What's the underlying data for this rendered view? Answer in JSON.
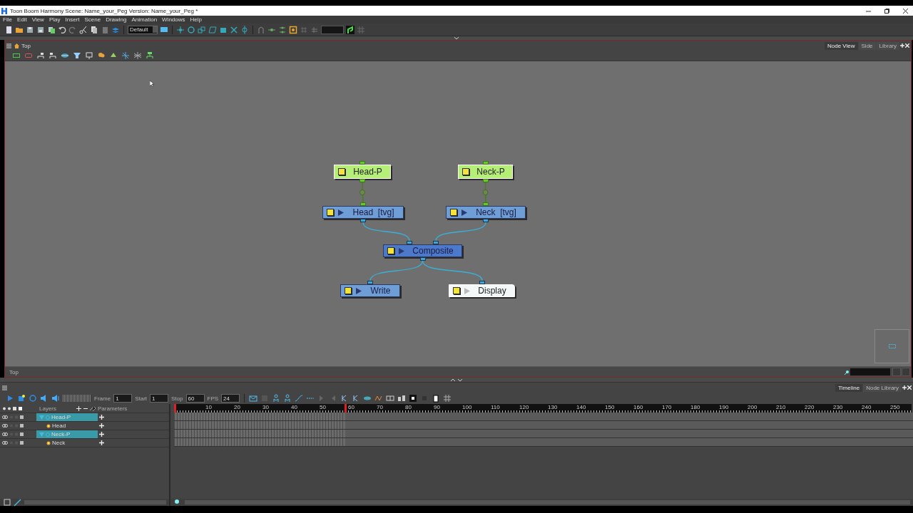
{
  "window": {
    "title": "Toon Boom Harmony Scene: Name_your_Peg Version: Name_your_Peg *"
  },
  "menu": [
    "File",
    "Edit",
    "View",
    "Play",
    "Insert",
    "Scene",
    "Drawing",
    "Animation",
    "Windows",
    "Help"
  ],
  "toolbar": {
    "view_dropdown": "Default"
  },
  "node_view": {
    "breadcrumb": "Top",
    "tabs": [
      {
        "label": "Node View",
        "selected": true
      },
      {
        "label": "Side",
        "selected": false
      },
      {
        "label": "Library",
        "selected": false
      }
    ],
    "nodes": [
      {
        "label": "Head-P",
        "kind": "peg"
      },
      {
        "label": "Neck-P",
        "kind": "peg"
      },
      {
        "label": "Head  [tvg]",
        "kind": "drawing"
      },
      {
        "label": "Neck  [tvg]",
        "kind": "drawing"
      },
      {
        "label": "Composite",
        "kind": "composite"
      },
      {
        "label": "Write",
        "kind": "write"
      },
      {
        "label": "Display",
        "kind": "display"
      }
    ],
    "footer_label": "Top"
  },
  "timeline": {
    "tabs": [
      {
        "label": "Timeline",
        "selected": true
      },
      {
        "label": "Node Library",
        "selected": false
      }
    ],
    "fields": [
      {
        "label": "Frame",
        "value": "1"
      },
      {
        "label": "Start",
        "value": "1"
      },
      {
        "label": "Stop",
        "value": "60"
      },
      {
        "label": "FPS",
        "value": "24"
      }
    ],
    "columns": [
      "Layers",
      "Parameters"
    ],
    "ruler": [
      "10",
      "20",
      "30",
      "40",
      "50",
      "60",
      "70",
      "80",
      "90",
      "100",
      "110",
      "120",
      "130",
      "140",
      "150",
      "160",
      "170",
      "180",
      "190",
      "200",
      "210",
      "220",
      "230",
      "240",
      "250"
    ],
    "layers": [
      {
        "name": "Head-P",
        "selected": true,
        "expanded": true,
        "children": [
          {
            "name": "Head",
            "selected": false
          }
        ]
      },
      {
        "name": "Neck-P",
        "selected": true,
        "expanded": true,
        "children": [
          {
            "name": "Neck",
            "selected": false
          }
        ]
      }
    ]
  }
}
